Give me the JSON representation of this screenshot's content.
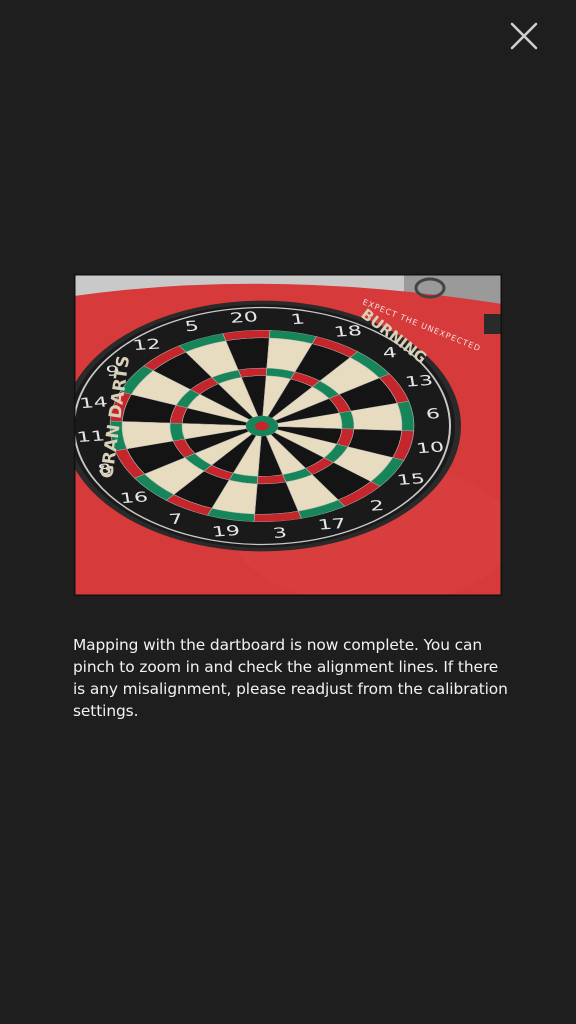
{
  "header": {
    "close_icon": "close-icon"
  },
  "photo": {
    "subject": "dartboard",
    "board_brand": "GRAN DARTS",
    "board_model": "BURNING",
    "backdrop_text": "EXPECT THE UNEXPECTED",
    "numbers": [
      "20",
      "1",
      "18",
      "4",
      "13",
      "6",
      "10",
      "15",
      "2",
      "17",
      "3",
      "19",
      "7",
      "16",
      "8",
      "11",
      "14",
      "9",
      "12",
      "5"
    ],
    "colors": {
      "background_red": "#d63a3a",
      "ring_red": "#c4262b",
      "ring_green": "#17855a",
      "segment_dark": "#141414",
      "segment_light": "#e8dcc0"
    }
  },
  "message": {
    "text": "Mapping with the dartboard is now complete. You can pinch to zoom in and check the alignment lines. If there is any misalignment, please readjust from the calibration settings."
  },
  "theme": {
    "background": "#1e1e1e",
    "text": "#f2f2f2"
  }
}
